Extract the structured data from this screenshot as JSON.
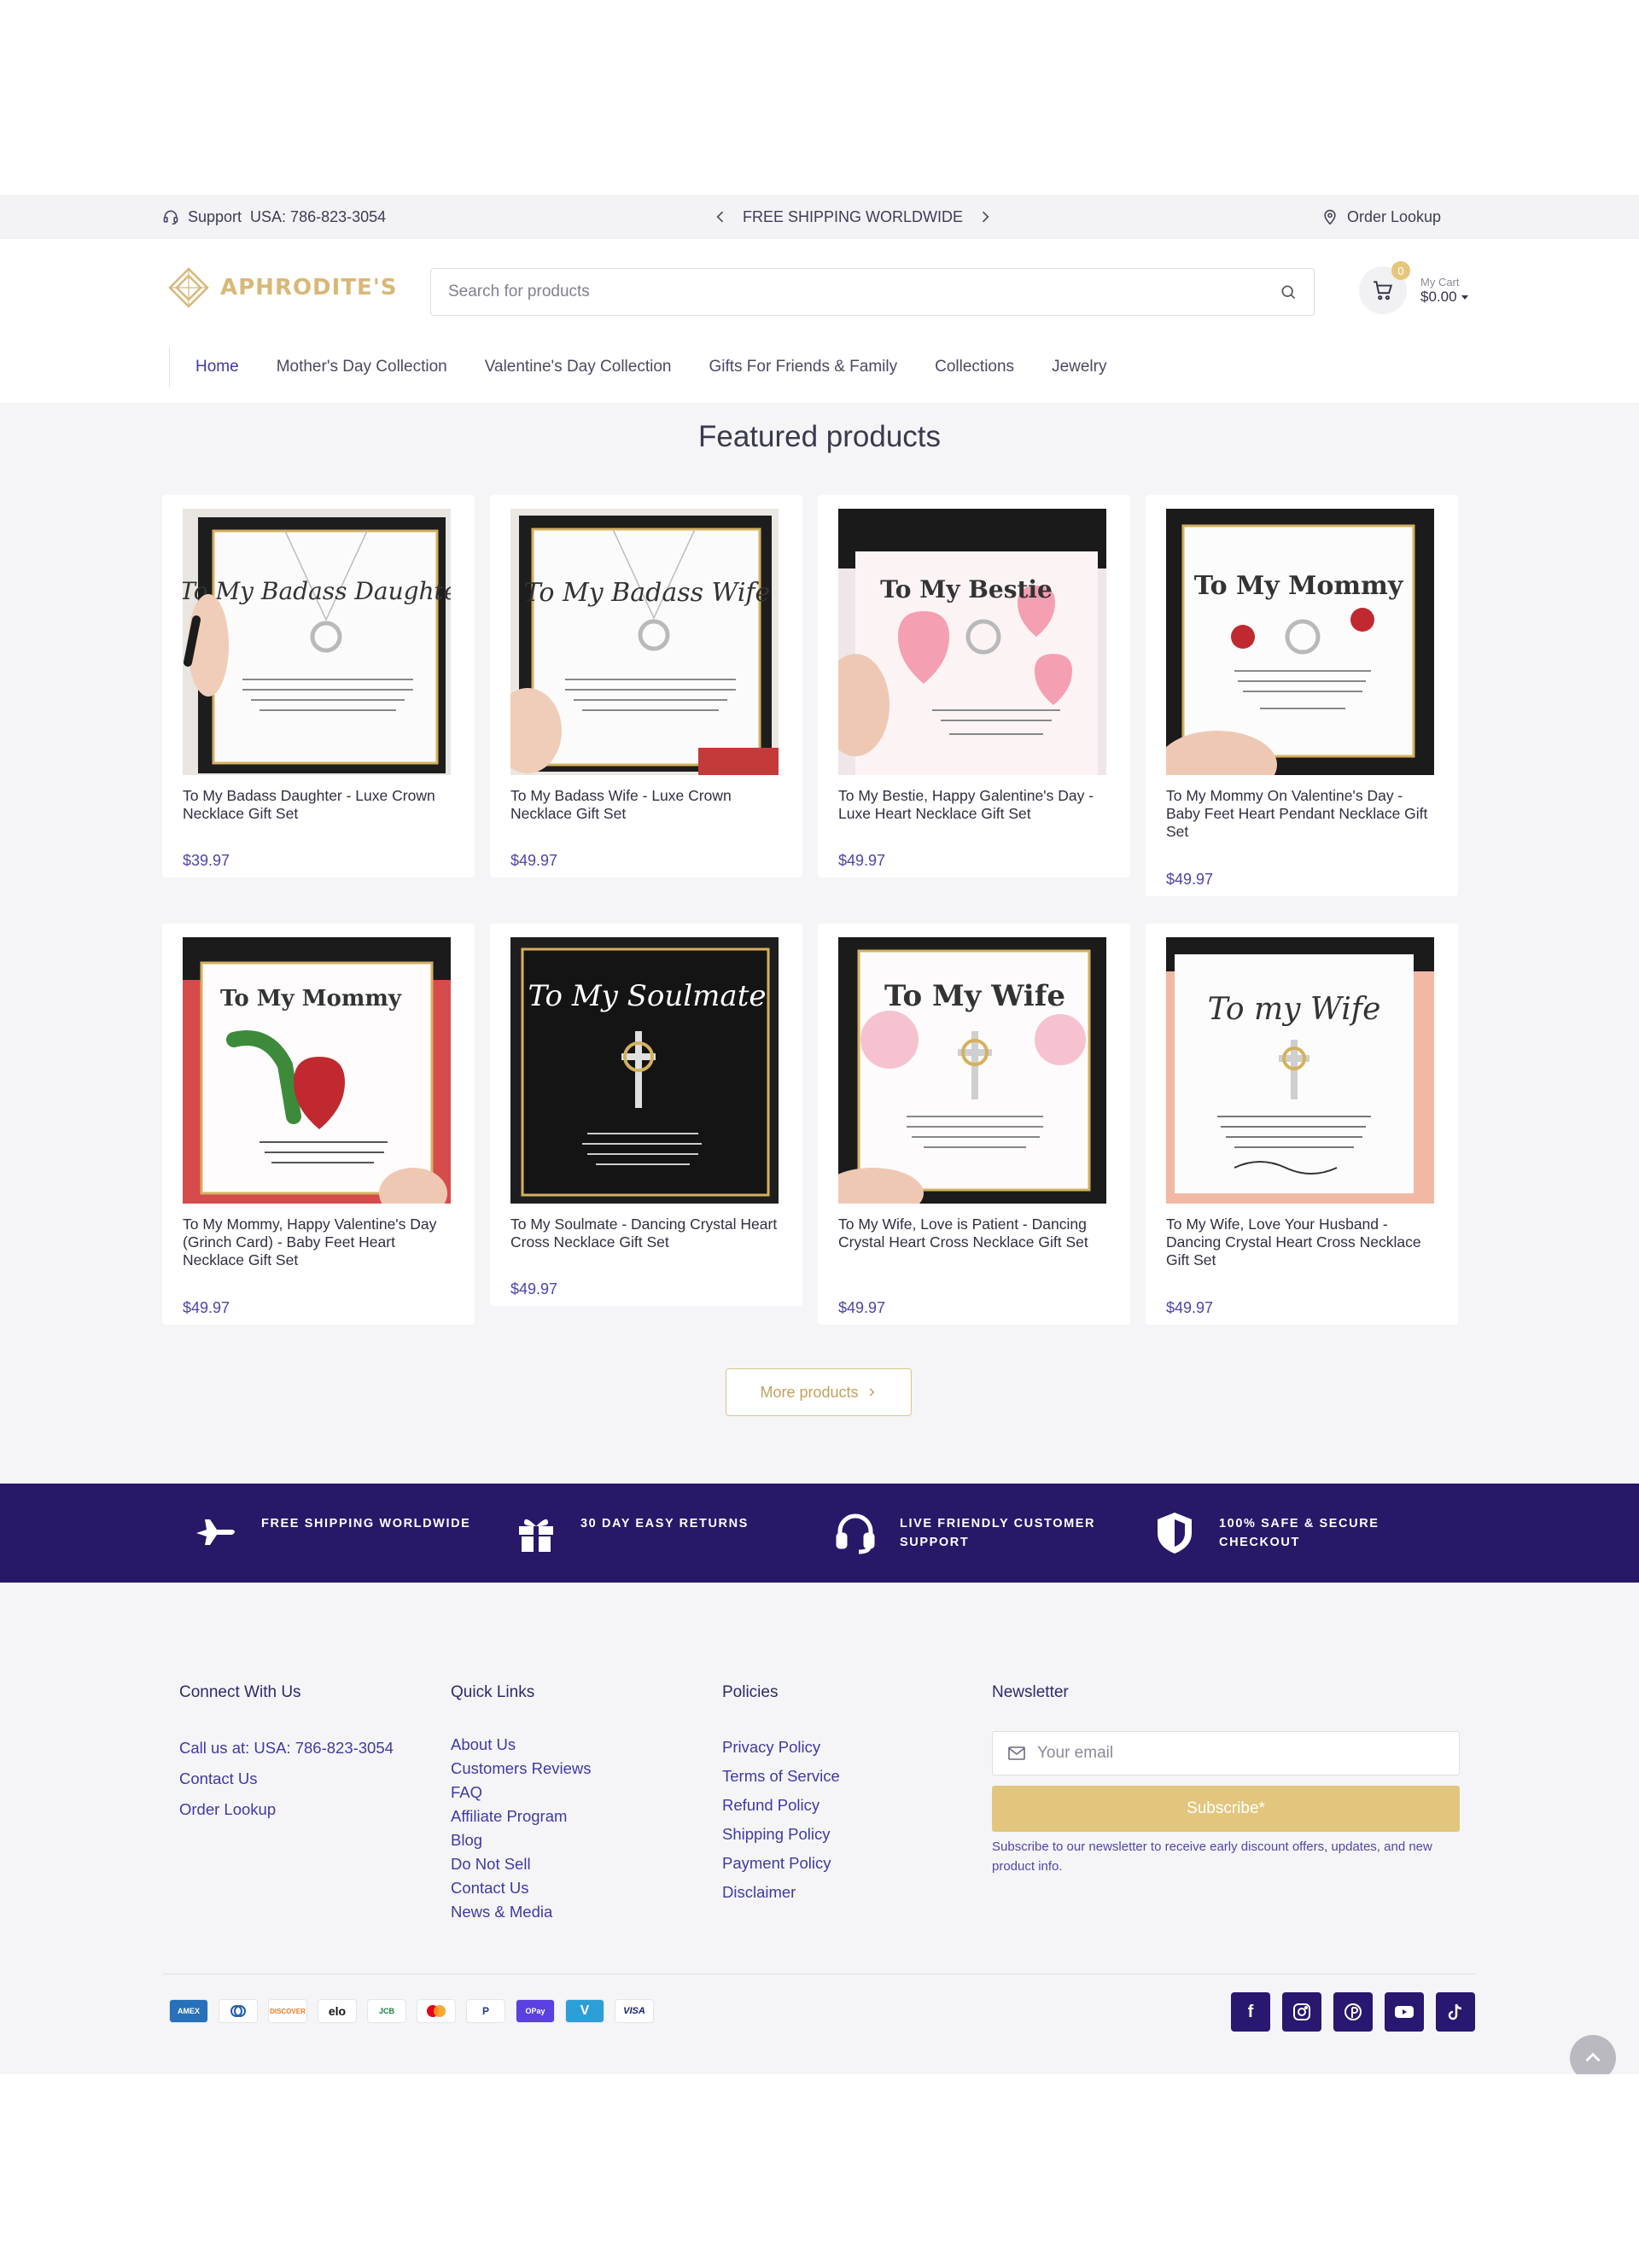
{
  "support_bar": {
    "support_label": "Support",
    "support_phone": "USA: 786-823-3054",
    "promo": "FREE SHIPPING WORLDWIDE",
    "order_lookup": "Order Lookup"
  },
  "header": {
    "logo_text": "APHRODITE'S",
    "search_placeholder": "Search for products",
    "cart": {
      "count": "0",
      "label": "My Cart",
      "total": "$0.00"
    }
  },
  "nav": [
    "Home",
    "Mother's Day Collection",
    "Valentine's Day Collection",
    "Gifts For Friends & Family",
    "Collections",
    "Jewelry"
  ],
  "featured": {
    "title": "Featured products",
    "products": [
      {
        "title": "To My Badass Daughter - Luxe Crown Necklace Gift Set",
        "price": "$39.97",
        "image_text": "To My Badass Daughter"
      },
      {
        "title": "To My Badass Wife - Luxe Crown Necklace Gift Set",
        "price": "$49.97",
        "image_text": "To My Badass Wife"
      },
      {
        "title": "To My Bestie, Happy Galentine's Day - Luxe Heart Necklace Gift Set",
        "price": "$49.97",
        "image_text": "To My Bestie"
      },
      {
        "title": "To My Mommy On Valentine's Day - Baby Feet Heart Pendant Necklace Gift Set",
        "price": "$49.97",
        "image_text": "To My Mommy"
      },
      {
        "title": "To My Mommy, Happy Valentine's Day (Grinch Card) - Baby Feet Heart Necklace Gift Set",
        "price": "$49.97",
        "image_text": "To My Mommy"
      },
      {
        "title": "To My Soulmate - Dancing Crystal Heart Cross Necklace Gift Set",
        "price": "$49.97",
        "image_text": "To My Soulmate"
      },
      {
        "title": "To My Wife, Love is Patient - Dancing Crystal Heart Cross Necklace Gift Set",
        "price": "$49.97",
        "image_text": "To My Wife"
      },
      {
        "title": "To My Wife, Love Your Husband - Dancing Crystal Heart Cross Necklace Gift Set",
        "price": "$49.97",
        "image_text": "To my Wife"
      }
    ],
    "more_button": "More products"
  },
  "features": [
    {
      "icon": "airplane-icon",
      "text1": "FREE SHIPPING WORLDWIDE",
      "text2": ""
    },
    {
      "icon": "gift-icon",
      "text1": "30 DAY EASY RETURNS",
      "text2": ""
    },
    {
      "icon": "headset-icon",
      "text1": "LIVE FRIENDLY CUSTOMER",
      "text2": "SUPPORT"
    },
    {
      "icon": "shield-icon",
      "text1": "100% SAFE & SECURE",
      "text2": "CHECKOUT"
    }
  ],
  "footer": {
    "connect": {
      "heading": "Connect With Us",
      "items": [
        "Call us at: USA: 786-823-3054",
        "Contact Us",
        "Order Lookup"
      ]
    },
    "quick_links": {
      "heading": "Quick Links",
      "items": [
        "About Us",
        "Customers Reviews",
        "FAQ",
        "Affiliate Program",
        "Blog",
        "Do Not Sell",
        "Contact Us",
        "News & Media"
      ]
    },
    "policies": {
      "heading": "Policies",
      "items": [
        "Privacy Policy",
        "Terms of Service",
        "Refund Policy",
        "Shipping Policy",
        "Payment Policy",
        "Disclaimer"
      ]
    },
    "newsletter": {
      "heading": "Newsletter",
      "placeholder": "Your email",
      "button": "Subscribe*",
      "note": "Subscribe to our newsletter to receive early discount offers, updates, and new product info."
    },
    "payments": [
      "AMEX",
      "diners",
      "DISCOVER",
      "elo",
      "JCB",
      "mastercard",
      "PayPal",
      "OPay",
      "V",
      "VISA"
    ],
    "socials": [
      "facebook-icon",
      "instagram-icon",
      "pinterest-icon",
      "youtube-icon",
      "tiktok-icon"
    ]
  },
  "colors": {
    "brand_purple": "#291868",
    "accent_gold": "#e2c67e",
    "link_purple": "#3f3aa2",
    "price_purple": "#4b45a8"
  }
}
